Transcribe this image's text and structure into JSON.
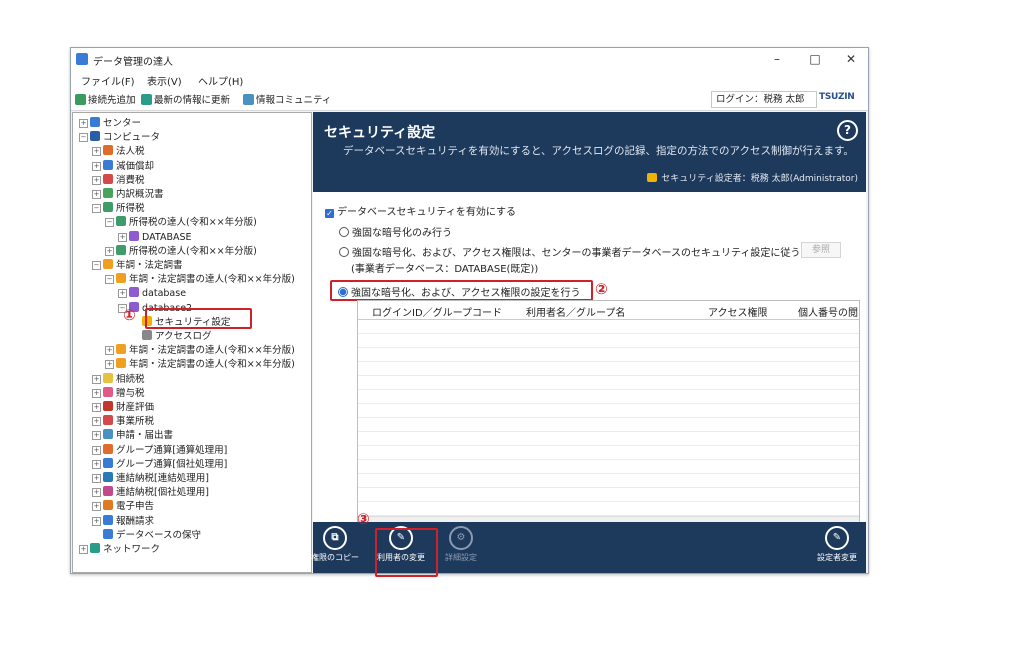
{
  "window": {
    "title": "データ管理の達人",
    "minimize": "–",
    "maximize": "□",
    "close": "✕"
  },
  "menu": [
    "ファイル(F)",
    "表示(V)",
    "ヘルプ(H)"
  ],
  "toolbar": {
    "items": [
      "接続先追加",
      "最新の情報に更新",
      "情報コミュニティ"
    ],
    "login": "ログイン：税務 太郎",
    "logo": "TSUZIN"
  },
  "tree": [
    {
      "label": "センター",
      "level": 0,
      "exp": "+",
      "color": "#3a7bd5"
    },
    {
      "label": "コンピュータ",
      "level": 0,
      "exp": "-",
      "color": "#2a5da8"
    },
    {
      "label": "法人税",
      "level": 1,
      "exp": "+",
      "color": "#e06c2c"
    },
    {
      "label": "減価償却",
      "level": 1,
      "exp": "+",
      "color": "#3a7bd5"
    },
    {
      "label": "消費税",
      "level": 1,
      "exp": "+",
      "color": "#d24a4a"
    },
    {
      "label": "内訳概況書",
      "level": 1,
      "exp": "+",
      "color": "#4aa35c"
    },
    {
      "label": "所得税",
      "level": 1,
      "exp": "-",
      "color": "#3d9c67"
    },
    {
      "label": "所得税の達人(令和××年分版)",
      "level": 2,
      "exp": "-",
      "color": "#3d9c67"
    },
    {
      "label": "DATABASE",
      "level": 3,
      "exp": "+",
      "color": "#8f5bd1"
    },
    {
      "label": "所得税の達人(令和××年分版)",
      "level": 2,
      "exp": "+",
      "color": "#3d9c67"
    },
    {
      "label": "年調・法定調書",
      "level": 1,
      "exp": "-",
      "color": "#f0a020"
    },
    {
      "label": "年調・法定調書の達人(令和××年分版)",
      "level": 2,
      "exp": "-",
      "color": "#f0a020"
    },
    {
      "label": "database",
      "level": 3,
      "exp": "+",
      "color": "#8f5bd1"
    },
    {
      "label": "database2",
      "level": 3,
      "exp": "-",
      "color": "#8f5bd1"
    },
    {
      "label": "セキュリティ設定",
      "level": 4,
      "exp": "",
      "color": "#f0b400"
    },
    {
      "label": "アクセスログ",
      "level": 4,
      "exp": "",
      "color": "#888888"
    },
    {
      "label": "年調・法定調書の達人(令和××年分版)",
      "level": 2,
      "exp": "+",
      "color": "#f0a020"
    },
    {
      "label": "年調・法定調書の達人(令和××年分版)",
      "level": 2,
      "exp": "+",
      "color": "#f0a020"
    },
    {
      "label": "相続税",
      "level": 1,
      "exp": "+",
      "color": "#e8c040"
    },
    {
      "label": "贈与税",
      "level": 1,
      "exp": "+",
      "color": "#e05a8a"
    },
    {
      "label": "財産評価",
      "level": 1,
      "exp": "+",
      "color": "#c0392b"
    },
    {
      "label": "事業所税",
      "level": 1,
      "exp": "+",
      "color": "#d24a4a"
    },
    {
      "label": "申請・届出書",
      "level": 1,
      "exp": "+",
      "color": "#4a90c2"
    },
    {
      "label": "グループ通算[通算処理用]",
      "level": 1,
      "exp": "+",
      "color": "#e06c2c"
    },
    {
      "label": "グループ通算[個社処理用]",
      "level": 1,
      "exp": "+",
      "color": "#3a7bd5"
    },
    {
      "label": "連結納税[連結処理用]",
      "level": 1,
      "exp": "+",
      "color": "#2a7ab5"
    },
    {
      "label": "連結納税[個社処理用]",
      "level": 1,
      "exp": "+",
      "color": "#c04a8a"
    },
    {
      "label": "電子申告",
      "level": 1,
      "exp": "+",
      "color": "#e07a20"
    },
    {
      "label": "報酬請求",
      "level": 1,
      "exp": "+",
      "color": "#3a7bd5"
    },
    {
      "label": "データベースの保守",
      "level": 1,
      "exp": "",
      "color": "#3a7bd5"
    },
    {
      "label": "ネットワーク",
      "level": 0,
      "exp": "+",
      "color": "#2a9c8a"
    }
  ],
  "annotations": {
    "one": "①",
    "two": "②",
    "three": "③"
  },
  "panel": {
    "title": "セキュリティ設定",
    "description": "データベースセキュリティを有効にすると、アクセスログの記録、指定の方法でのアクセス制御が行えます。",
    "setter": "セキュリティ設定者：税務 太郎(Administrator)",
    "help": "?",
    "enable_label": "データベースセキュリティを有効にする",
    "opt1": "強固な暗号化のみ行う",
    "opt2": "強固な暗号化、および、アクセス権限は、センターの事業者データベースのセキュリティ設定に従う",
    "opt2_sub": "(事業者データベース：DATABASE(既定))",
    "ref_button": "参照",
    "opt3": "強固な暗号化、および、アクセス権限の設定を行う",
    "columns": [
      "ログインID／グループコード",
      "利用者名／グループ名",
      "アクセス権限",
      "個人番号の閲"
    ]
  },
  "bottom": {
    "copy": "権限のコピー",
    "change_user": "利用者の変更",
    "detail": "詳細設定",
    "change_setter": "設定者変更"
  }
}
